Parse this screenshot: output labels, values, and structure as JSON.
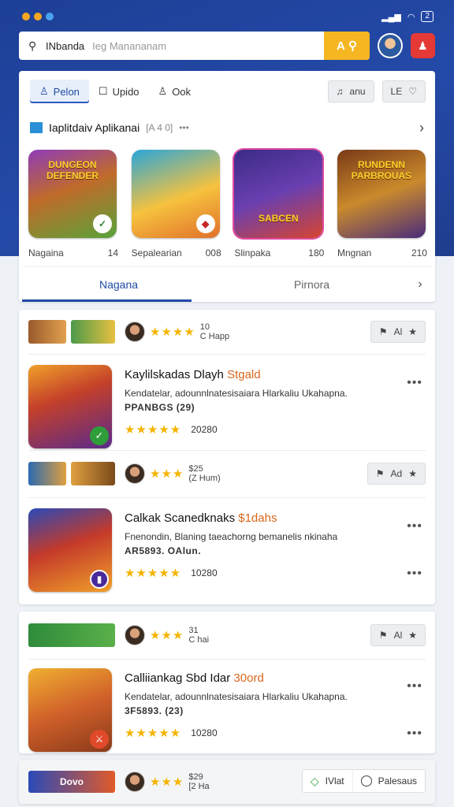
{
  "status_bar": {
    "battery": "2"
  },
  "search": {
    "value": "INbanda",
    "placeholder": "Ieg Manananam",
    "button": "A"
  },
  "filters": {
    "active": "Pelon",
    "second": "Upido",
    "third": "Ook",
    "right1": "anu",
    "right2": "LE"
  },
  "section": {
    "title": "Iaplitdaiv Aplikanai",
    "count": "[A 4 0]",
    "more": "•••"
  },
  "games": [
    {
      "banner": "DUNGEON DEFENDER",
      "name": "Nagaina",
      "num": "14",
      "color1": "#5aa33a",
      "color2": "#8e3bb8"
    },
    {
      "banner": "",
      "name": "Sepalearian",
      "num": "008",
      "color1": "#f6c23e",
      "color2": "#2aa6d9"
    },
    {
      "banner": "SABCEN",
      "name": "Slinpaka",
      "num": "180",
      "color1": "#3b2b87",
      "color2": "#d6452f"
    },
    {
      "banner": "RUNDENN PARBROUAS",
      "name": "Mngnan",
      "num": "210",
      "color1": "#7a3a18",
      "color2": "#c98a2c"
    }
  ],
  "tabs": {
    "first": "Nagana",
    "second": "Pirnora"
  },
  "strips": [
    {
      "stars": "★★★★",
      "line1": "10",
      "line2": "C Happ",
      "action": "Al"
    },
    {
      "stars": "★★★",
      "line1": "$25",
      "line2": "(Z Hum)",
      "action": "Ad"
    },
    {
      "stars": "★★★",
      "line1": "31",
      "line2": "C hai",
      "action": "Al"
    },
    {
      "stars": "★★★",
      "line1": "$29",
      "line2": "[2 Ha",
      "thumb_text": "Dovo"
    }
  ],
  "rows": [
    {
      "title_main": "Kaylilskadas Dlayh",
      "title_hl": "Stgald",
      "desc": "Kendatelar, adounnlnatesisaiara Hlarkaliu Ukahapna.",
      "sub": "PPANBGS (29)",
      "stars": "★★★★★",
      "rating_num": "20280"
    },
    {
      "title_main": "Calkak Scanedknaks",
      "title_hl": "$1dahs",
      "desc": "Fnenondin, Blaning taeachorng bemanelis nkinaha",
      "sub": "AR5893.  OAlun.",
      "stars": "★★★★★",
      "rating_num": "10280"
    },
    {
      "title_main": "Calliiankag Sbd Idar",
      "title_hl": "30ord",
      "desc": "Kendatelar, adounnlnatesisaiara Hlarkaliu Ukahapna.",
      "sub": "3F5893. (23)",
      "stars": "★★★★★",
      "rating_num": "10280"
    }
  ],
  "footer": {
    "btn1": "IVlat",
    "btn2": "Palesaus"
  },
  "colors": {
    "brand": "#1f4aa5",
    "accent": "#f5b621",
    "star": "#f5b400"
  }
}
